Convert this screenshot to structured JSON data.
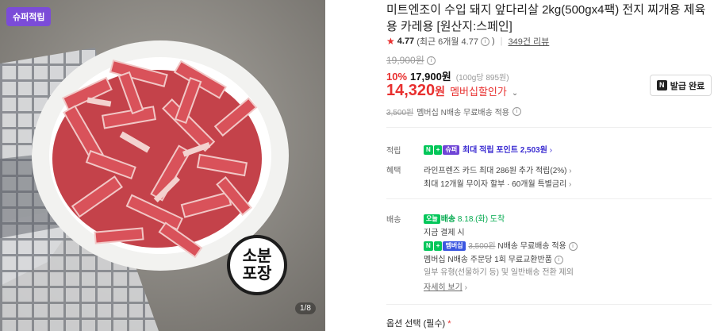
{
  "image": {
    "badge": "슈퍼적립",
    "sticker_line1": "소분",
    "sticker_line2": "포장",
    "counter": "1/8"
  },
  "product": {
    "title": "미트엔조이 수입 돼지 앞다리살 2kg(500gx4팩) 전지 찌개용 제육용 카레용 [원산지:스페인]",
    "rating": "4.77",
    "rating_recent": "(최근 6개월 4.77",
    "review_count": "349건 리뷰",
    "original_price": "19,900원",
    "discount_pct": "10%",
    "sale_price": "17,900원",
    "unit_price": "(100g당 895원)",
    "member_price": "14,320",
    "member_won": "원",
    "member_label": "멤버십할인가",
    "coupon_button": "발급 완료",
    "ship_strike": "3,500원",
    "ship_note": "멤버십 N배송 무료배송 적용"
  },
  "benefits": {
    "points_label": "적립",
    "points_pill_n": "N",
    "points_pill_plus": "+",
    "points_pill_super": "슈퍼",
    "points_text": "최대 적립 포인트 2,503원",
    "benefit_label": "혜택",
    "benefit_line1": "라인프렌즈 카드 최대 286원 추가 적립(2%)",
    "benefit_line2": "최대 12개월 무이자 할부 · 60개월 특별금리"
  },
  "delivery": {
    "label": "배송",
    "today_badge": "오늘",
    "today_word": "배송",
    "date": "8.18.(화) 도착",
    "pay_now": "지금 결제 시",
    "n_pill": "N",
    "plus_pill": "+",
    "member_pill": "멤버십",
    "ship_strike": "3,500원",
    "ship_free": "N배송 무료배송 적용",
    "exchange": "멤버십 N배송 주문당 1회 무료교환반품",
    "exclude": "일부 유형(선물하기 등) 및 일반배송 전환 제외",
    "detail_link": "자세히 보기"
  },
  "options": {
    "title": "옵션 선택 (필수)",
    "required_mark": "*"
  },
  "colors": {
    "accent_red": "#e8302f",
    "naver_green": "#03c75a",
    "super_purple": "#7b4cd8",
    "points_blue": "#3a2bd1"
  },
  "icons": [
    "star-icon",
    "info-icon",
    "chevron-down-icon",
    "chevron-right-icon",
    "n-membership-icon"
  ]
}
